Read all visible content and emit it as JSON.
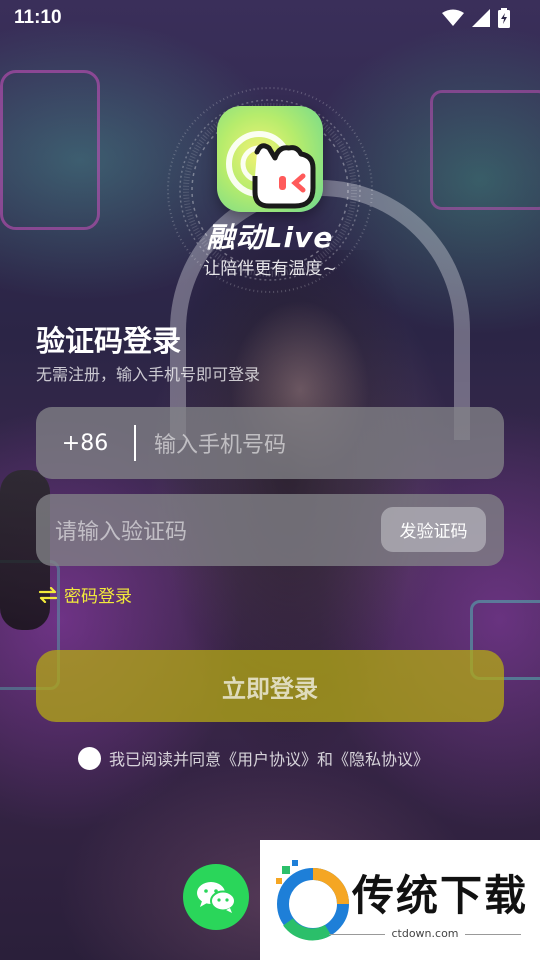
{
  "status_bar": {
    "time": "11:10"
  },
  "app": {
    "name": "融动Live",
    "slogan": "让陪伴更有温度~"
  },
  "login": {
    "title": "验证码登录",
    "subtitle": "无需注册，输入手机号即可登录",
    "country_code": "+86",
    "phone_placeholder": "输入手机号码",
    "code_placeholder": "请输入验证码",
    "send_code_label": "发验证码",
    "password_login_label": "密码登录",
    "submit_label": "立即登录",
    "agreement_text": "我已阅读并同意《用户协议》和《隐私协议》"
  },
  "watermark": {
    "brand": "传统下载",
    "site": "ctdown.com"
  },
  "colors": {
    "accent_yellow": "#f2ea3b",
    "login_button": "#b4aa14",
    "wechat_green": "#2ad65a"
  }
}
